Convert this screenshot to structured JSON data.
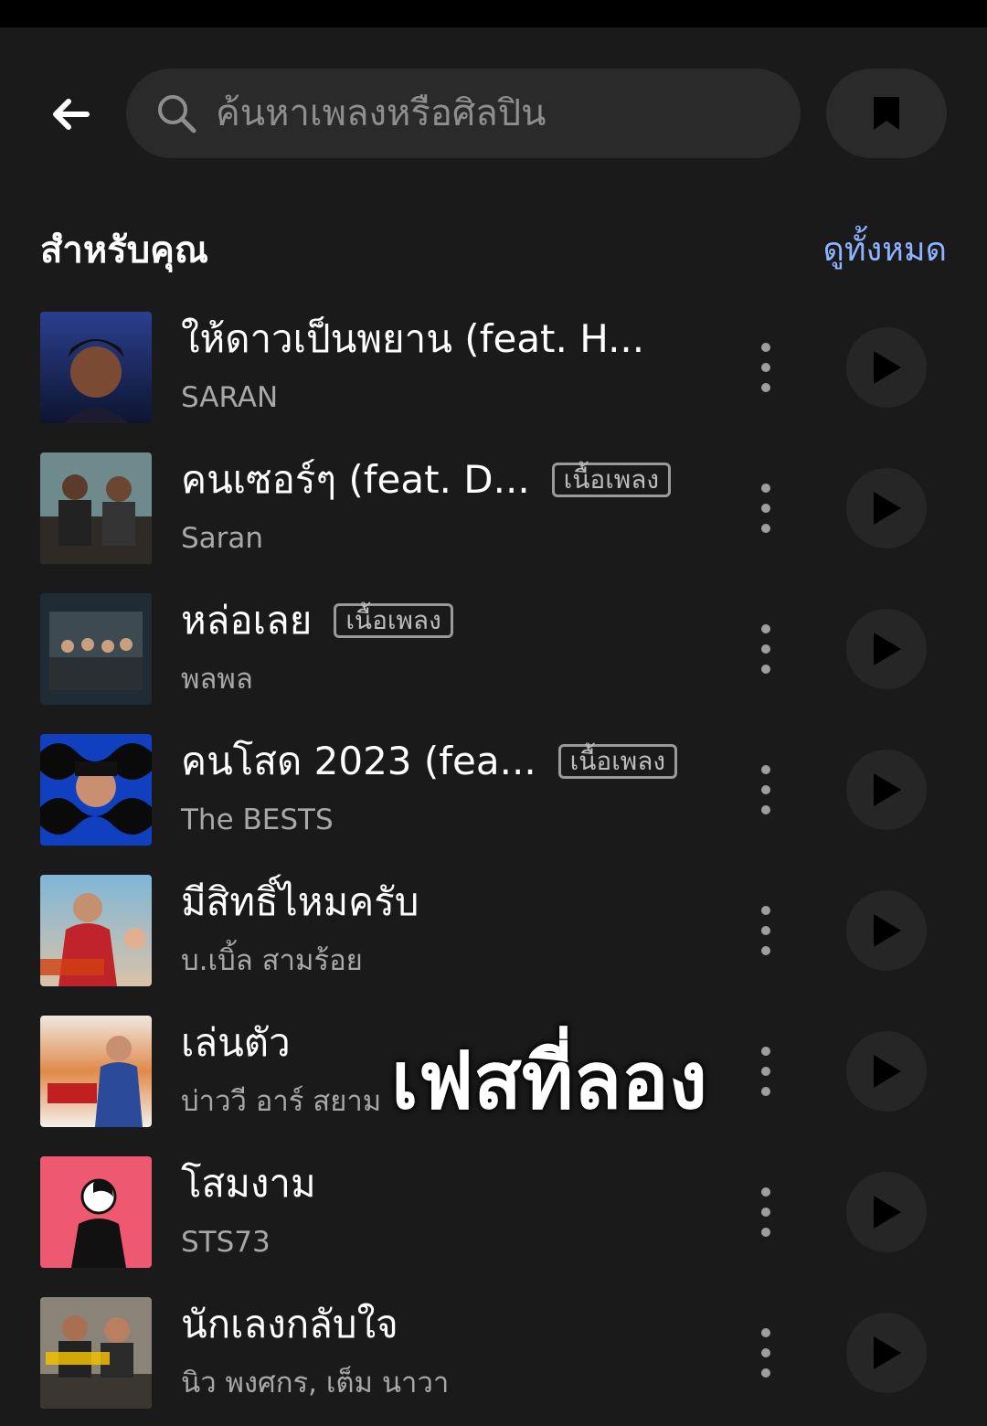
{
  "search": {
    "placeholder": "ค้นหาเพลงหรือศิลปิน"
  },
  "icons": {
    "back": "arrow-left-icon",
    "search": "search-icon",
    "bookmark": "bookmark-icon",
    "more": "more-vertical-icon",
    "play": "play-icon"
  },
  "section": {
    "title": "สำหรับคุณ",
    "see_all": "ดูทั้งหมด"
  },
  "colors": {
    "background": "#1a1a1a",
    "accent_link": "#8fb4ff",
    "surface": "#2a2a2a"
  },
  "songs": [
    {
      "title": "ให้ดาวเป็นพยาน (feat. H...",
      "artist": "SARAN",
      "badge": ""
    },
    {
      "title": "คนเซอร์ๆ (feat. D...",
      "artist": "Saran",
      "badge": "เนื้อเพลง"
    },
    {
      "title": "หล่อเลย",
      "artist": "พลพล",
      "badge": "เนื้อเพลง"
    },
    {
      "title": "คนโสด 2023 (fea...",
      "artist": "The BESTS",
      "badge": "เนื้อเพลง"
    },
    {
      "title": "มีสิทธิ์ไหมครับ",
      "artist": "บ.เบิ้ล สามร้อย",
      "badge": ""
    },
    {
      "title": "เล่นตัว",
      "artist": "บ่าววี อาร์ สยาม",
      "badge": ""
    },
    {
      "title": "โสมงาม",
      "artist": "STS73",
      "badge": ""
    },
    {
      "title": "นักเลงกลับใจ",
      "artist": "นิว พงศกร, เต็ม นาวา",
      "badge": ""
    }
  ],
  "overlay": {
    "text": "เฟสที่ลอง"
  }
}
